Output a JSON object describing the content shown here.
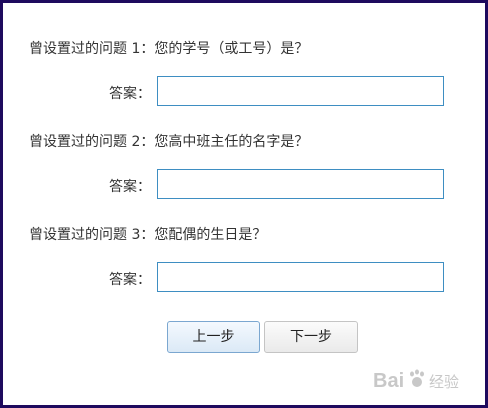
{
  "questions": [
    {
      "prompt": "曾设置过的问题 1：您的学号（或工号）是？",
      "answer_label": "答案：",
      "answer_value": ""
    },
    {
      "prompt": "曾设置过的问题 2：您高中班主任的名字是？",
      "answer_label": "答案：",
      "answer_value": ""
    },
    {
      "prompt": "曾设置过的问题 3：您配偶的生日是？",
      "answer_label": "答案：",
      "answer_value": ""
    }
  ],
  "buttons": {
    "prev": "上一步",
    "next": "下一步"
  },
  "watermark": {
    "text": "Bai 经验"
  },
  "colors": {
    "frame": "#1e0a5e",
    "input_border": "#3e8ec2",
    "text": "#333333"
  }
}
